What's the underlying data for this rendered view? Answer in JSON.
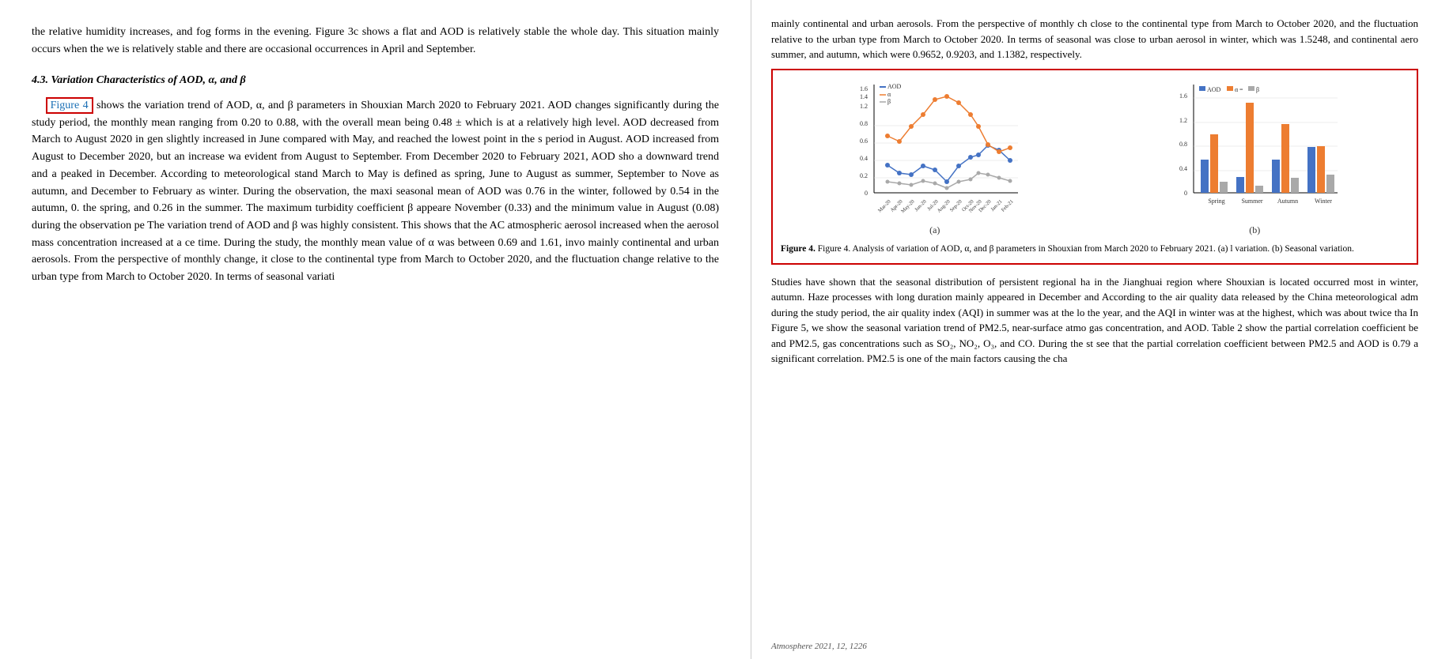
{
  "left": {
    "para1": "the relative humidity increases, and fog forms in the evening. Figure 3c shows a flat and AOD is relatively stable the whole day. This situation mainly occurs when the we is relatively stable and there are occasional occurrences in April and September.",
    "section_heading": "4.3. Variation Characteristics of AOD, α, and β",
    "figure4_ref": "Figure 4",
    "para2_a": " shows the variation trend of AOD, α, and β parameters in Shouxian March 2020 to February 2021. AOD changes significantly during the study period, the monthly mean ranging from 0.20 to 0.88, with the overall mean being 0.48 ± which is at a relatively high level. AOD decreased from March to August 2020 in gen slightly increased in June compared with May, and reached the lowest point in the s period in August. AOD increased from August to December 2020, but an increase wa evident from August to September. From December 2020 to February 2021, AOD sho a downward trend and a peaked in December. According to meteorological stand March to May is defined as spring, June to August as summer, September to Nove as autumn, and December to February as winter. During the observation, the maxi seasonal mean of AOD was 0.76 in the winter, followed by 0.54 in the autumn, 0. the spring, and 0.26 in the summer. The maximum turbidity coefficient β appeare November (0.33) and the minimum value in August (0.08) during the observation pe The variation trend of AOD and β was highly consistent. This shows that the AC atmospheric aerosol increased when the aerosol mass concentration increased at a ce time. During the study, the monthly mean value of α was between 0.69 and 1.61, invo mainly continental and urban aerosols. From the perspective of monthly change, it close to the continental type from March to October 2020, and the fluctuation change relative to the urban type from March to October 2020. In terms of seasonal variati",
    "from_text": "from"
  },
  "right": {
    "top_text": "mainly continental and urban aerosols. From the perspective of monthly ch close to the continental type from March to October 2020, and the fluctuation relative to the urban type from March to October 2020. In terms of seasonal was close to urban aerosol in winter, which was 1.5248, and continental aero summer, and autumn, which were 0.9652, 0.9203, and 1.1382, respectively.",
    "figure_caption": "Figure 4. Analysis of variation of AOD, α, and β parameters in Shouxian from March 2020 to February 2021. (a) l variation. (b) Seasonal variation.",
    "bottom_text_1": "Studies have shown that the seasonal distribution of persistent regional ha in the Jianghuai region where Shouxian is located occurred most in winter, autumn. Haze processes with long duration mainly appeared in December and According to the air quality data released by the China meteorological adm during the study period, the air quality index (AQI) in summer was at the lo the year, and the AQI in winter was at the highest, which was about twice tha In Figure 5, we show the seasonal variation trend of PM2.5, near-surface atmo gas concentration, and AOD. Table 2 show the partial correlation coefficient be and PM2.5, gas concentrations such as SO₂, NO₂, O₃, and CO. During the st see that the partial correlation coefficient between PM2.5 and AOD is 0.79 a significant correlation. PM2.5 is one of the main factors causing the cha",
    "footer": "Atmosphere 2021, 12, 1226",
    "chart_a_label": "(a)",
    "chart_b_label": "(b)",
    "legend_aod": "AOD",
    "legend_alpha": "α",
    "legend_beta": "β",
    "x_labels_monthly": [
      "Mar-20",
      "Apr-20",
      "May-20",
      "Jun-20",
      "Jul-20",
      "Aug-20",
      "Sep-20",
      "Oct-20",
      "Nov-20",
      "Dec-20",
      "Jan-21",
      "Feb-21"
    ],
    "aod_values": [
      0.46,
      0.35,
      0.32,
      0.45,
      0.38,
      0.2,
      0.45,
      0.6,
      0.65,
      0.88,
      0.76,
      0.55
    ],
    "alpha_values": [
      0.95,
      0.85,
      1.1,
      1.3,
      1.55,
      1.61,
      1.5,
      1.3,
      1.1,
      0.8,
      0.69,
      0.75
    ],
    "beta_values": [
      0.18,
      0.16,
      0.14,
      0.2,
      0.16,
      0.08,
      0.18,
      0.22,
      0.33,
      0.3,
      0.25,
      0.2
    ],
    "x_labels_seasonal": [
      "Spring",
      "Summer",
      "Autumn",
      "Winter"
    ],
    "aod_seasonal": [
      0.54,
      0.26,
      0.54,
      0.76
    ],
    "alpha_seasonal": [
      0.97,
      1.49,
      1.14,
      0.76
    ],
    "beta_seasonal": [
      0.18,
      0.12,
      0.25,
      0.3
    ]
  }
}
